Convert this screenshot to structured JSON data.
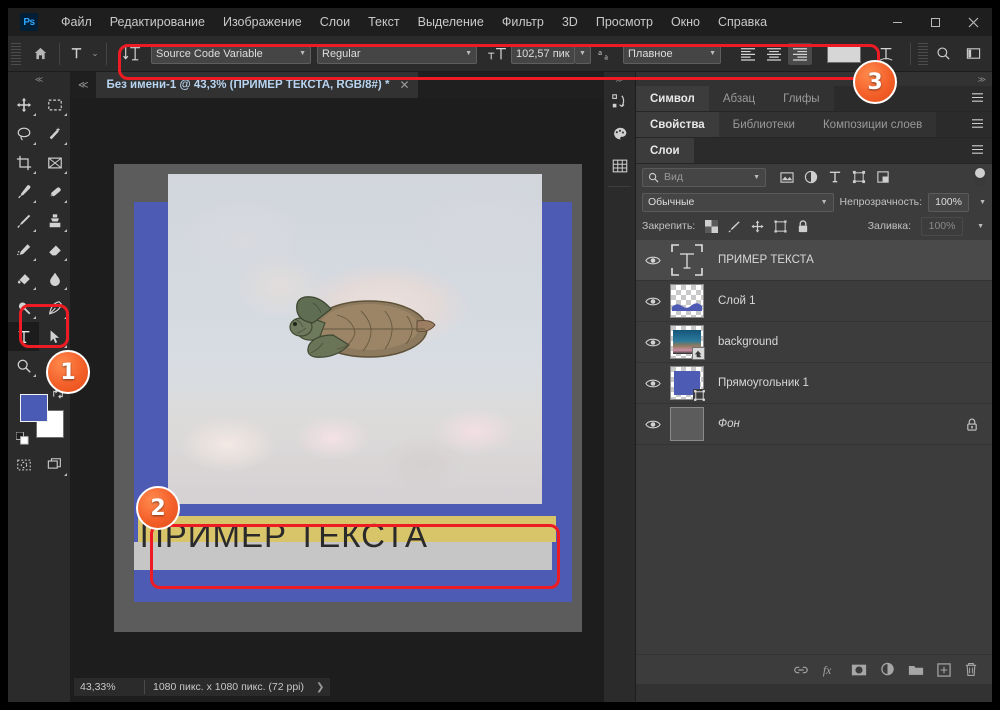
{
  "app": {
    "logo": "Ps"
  },
  "menu": {
    "items": [
      "Файл",
      "Редактирование",
      "Изображение",
      "Слои",
      "Текст",
      "Выделение",
      "Фильтр",
      "3D",
      "Просмотр",
      "Окно",
      "Справка"
    ]
  },
  "window_controls": {
    "minimize": "—",
    "maximize": "❐",
    "close": "✕"
  },
  "options_bar": {
    "home_icon": "home-icon",
    "tool_icon": "type-tool-icon",
    "tool_caret": "⌄",
    "orientation_icon": "text-orientation-icon",
    "font_family": "Source Code Variable",
    "font_style": "Regular",
    "size_icon": "font-size-icon",
    "font_size": "102,57 пик",
    "antialias_icon": "anti-alias-icon",
    "antialias_value": "Плавное",
    "align_left": "align-left-icon",
    "align_center": "align-center-icon",
    "align_right": "align-right-icon",
    "color_swatch": "#d6d6d6",
    "warp_icon": "warp-text-icon",
    "panel_icon": "character-panel-icon",
    "search_icon": "search-icon",
    "workspace_icon": "workspace-icon",
    "more": "≫"
  },
  "tools": {
    "collapse": "≪",
    "rows": [
      [
        {
          "name": "move-tool",
          "glyph": "move"
        },
        {
          "name": "marquee-tool",
          "glyph": "marquee"
        }
      ],
      [
        {
          "name": "lasso-tool",
          "glyph": "lasso"
        },
        {
          "name": "quick-selection-tool",
          "glyph": "wand"
        }
      ],
      [
        {
          "name": "crop-tool",
          "glyph": "crop"
        },
        {
          "name": "frame-tool",
          "glyph": "frame"
        }
      ],
      [
        {
          "name": "eyedropper-tool",
          "glyph": "eyedropper"
        },
        {
          "name": "healing-brush-tool",
          "glyph": "healing"
        }
      ],
      [
        {
          "name": "brush-tool",
          "glyph": "brush"
        },
        {
          "name": "clone-stamp-tool",
          "glyph": "stamp"
        }
      ],
      [
        {
          "name": "history-brush-tool",
          "glyph": "historybrush"
        },
        {
          "name": "eraser-tool",
          "glyph": "eraser"
        }
      ],
      [
        {
          "name": "gradient-tool",
          "glyph": "bucket"
        },
        {
          "name": "blur-tool",
          "glyph": "blur"
        }
      ],
      [
        {
          "name": "dodge-tool",
          "glyph": "dodge"
        },
        {
          "name": "pen-tool",
          "glyph": "pen"
        }
      ],
      [
        {
          "name": "type-tool",
          "glyph": "type",
          "selected": true
        },
        {
          "name": "path-selection-tool",
          "glyph": "arrow"
        }
      ],
      [
        {
          "name": "zoom-tool",
          "glyph": "zoom"
        },
        {
          "name": "rotate-view-tool",
          "glyph": "rotate"
        }
      ]
    ],
    "foreground_color": "#4a5bb5",
    "background_color": "#ffffff",
    "bottom": [
      {
        "name": "quick-mask-button",
        "glyph": "quickmask"
      },
      {
        "name": "screen-mode-button",
        "glyph": "screenmode"
      }
    ]
  },
  "document": {
    "collapse": "≪",
    "tab_title": "Без имени-1 @ 43,3% (ПРИМЕР ТЕКСТА, RGB/8#) *",
    "close": "✕",
    "canvas_text": "ПРИМЕР  ТЕКСТА",
    "rect_color": "#4d5bb5",
    "highlight_top_color": "#d8c469",
    "highlight_bottom_color": "#c6c6c6"
  },
  "status_bar": {
    "zoom": "43,33%",
    "info": "1080 пикс. x 1080 пикс. (72 ppi)",
    "arrow": "❯"
  },
  "rail": {
    "collapse": "≫",
    "icons": [
      {
        "name": "history-icon"
      },
      {
        "name": "swatches-icon"
      },
      {
        "name": "gradients-icon"
      }
    ]
  },
  "dock": {
    "collapse": "≫",
    "menu_icon": "panel-menu-icon",
    "groups": [
      {
        "tabs": [
          {
            "label": "Символ",
            "active": true
          },
          {
            "label": "Абзац",
            "active": false
          },
          {
            "label": "Глифы",
            "active": false
          }
        ]
      },
      {
        "tabs": [
          {
            "label": "Свойства",
            "active": true
          },
          {
            "label": "Библиотеки",
            "active": false
          },
          {
            "label": "Композиции слоев",
            "active": false
          }
        ]
      },
      {
        "tabs": [
          {
            "label": "Слои",
            "active": true
          }
        ]
      }
    ]
  },
  "layers_panel": {
    "filter_placeholder": "Вид",
    "filter_icons": [
      "image-filter-icon",
      "adjustment-filter-icon",
      "type-filter-icon",
      "shape-filter-icon",
      "smart-object-filter-icon"
    ],
    "blend_mode": "Обычные",
    "opacity_label": "Непрозрачность:",
    "opacity_value": "100%",
    "lock_label": "Закрепить:",
    "lock_icons": [
      "lock-transparency-icon",
      "lock-image-icon",
      "lock-position-icon",
      "lock-artboard-icon",
      "lock-all-icon"
    ],
    "fill_label": "Заливка:",
    "fill_value": "100%",
    "layers": [
      {
        "name": "ПРИМЕР ТЕКСТА",
        "thumb": "text",
        "selected": true,
        "locked": false,
        "visible": true
      },
      {
        "name": "Слой 1",
        "thumb": "wave",
        "selected": false,
        "locked": false,
        "visible": true
      },
      {
        "name": "background",
        "thumb": "photo",
        "selected": false,
        "locked": false,
        "visible": true
      },
      {
        "name": "Прямоугольник 1",
        "thumb": "rect",
        "selected": false,
        "locked": false,
        "visible": true
      },
      {
        "name": "Фон",
        "thumb": "gray",
        "selected": false,
        "locked": true,
        "visible": true,
        "italic": true
      }
    ],
    "footer_icons": [
      "link-layers-icon",
      "layer-style-icon",
      "layer-mask-icon",
      "adjustment-layer-icon",
      "new-group-icon",
      "new-layer-icon",
      "delete-layer-icon"
    ]
  },
  "annotations": [
    {
      "label": "1"
    },
    {
      "label": "2"
    },
    {
      "label": "3"
    }
  ]
}
